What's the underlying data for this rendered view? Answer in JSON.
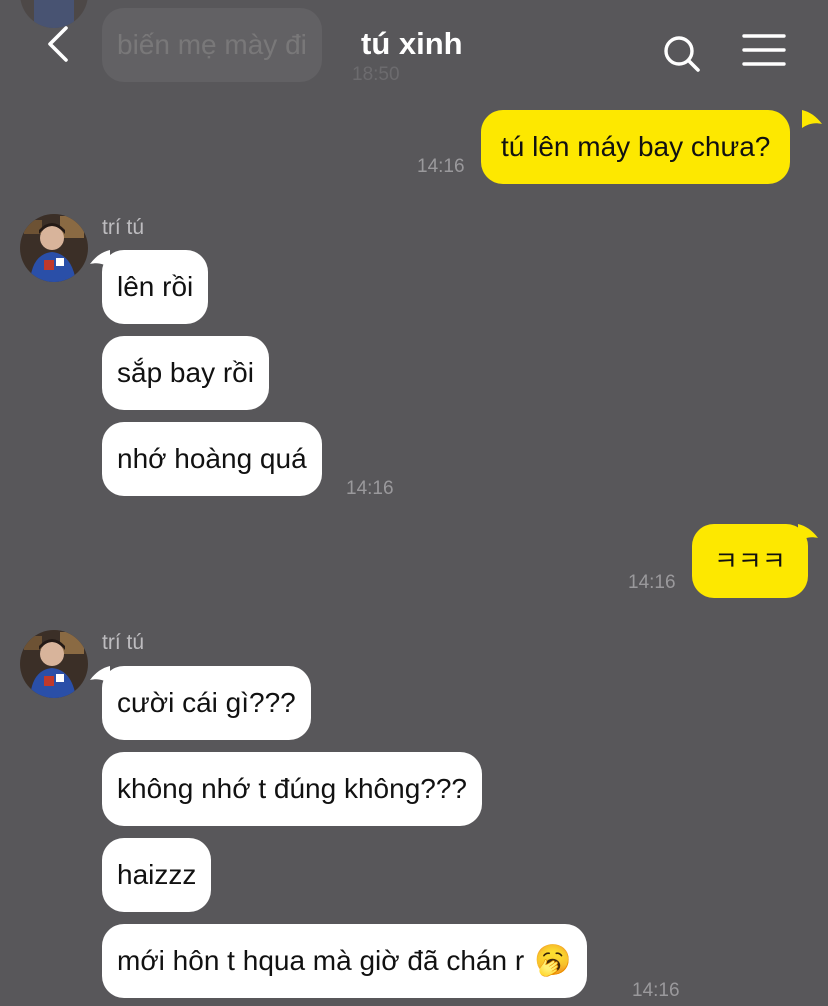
{
  "header": {
    "title": "tú xinh",
    "back_icon": "chevron-left-icon",
    "search_icon": "search-icon",
    "menu_icon": "hamburger-menu-icon"
  },
  "colors": {
    "background": "#58575a",
    "my_bubble": "#fde800",
    "their_bubble": "#ffffff"
  },
  "messages": {
    "prev": {
      "text": "biến mẹ mày đi",
      "time": "18:50"
    },
    "m1": {
      "text": "tú lên máy bay chưa?",
      "time": "14:16"
    },
    "g1": {
      "sender": "trí tú",
      "b1": "lên rồi",
      "b2": "sắp bay rồi",
      "b3": "nhớ hoàng quá",
      "time": "14:16"
    },
    "m2": {
      "text": "ㅋㅋㅋ",
      "time": "14:16"
    },
    "g2": {
      "sender": "trí tú",
      "b1": "cười cái gì???",
      "b2": "không nhớ t đúng không???",
      "b3": "haizzz",
      "b4": "mới hôn t hqua mà giờ đã chán r",
      "b4_emoji": "🥱",
      "time": "14:16"
    }
  }
}
